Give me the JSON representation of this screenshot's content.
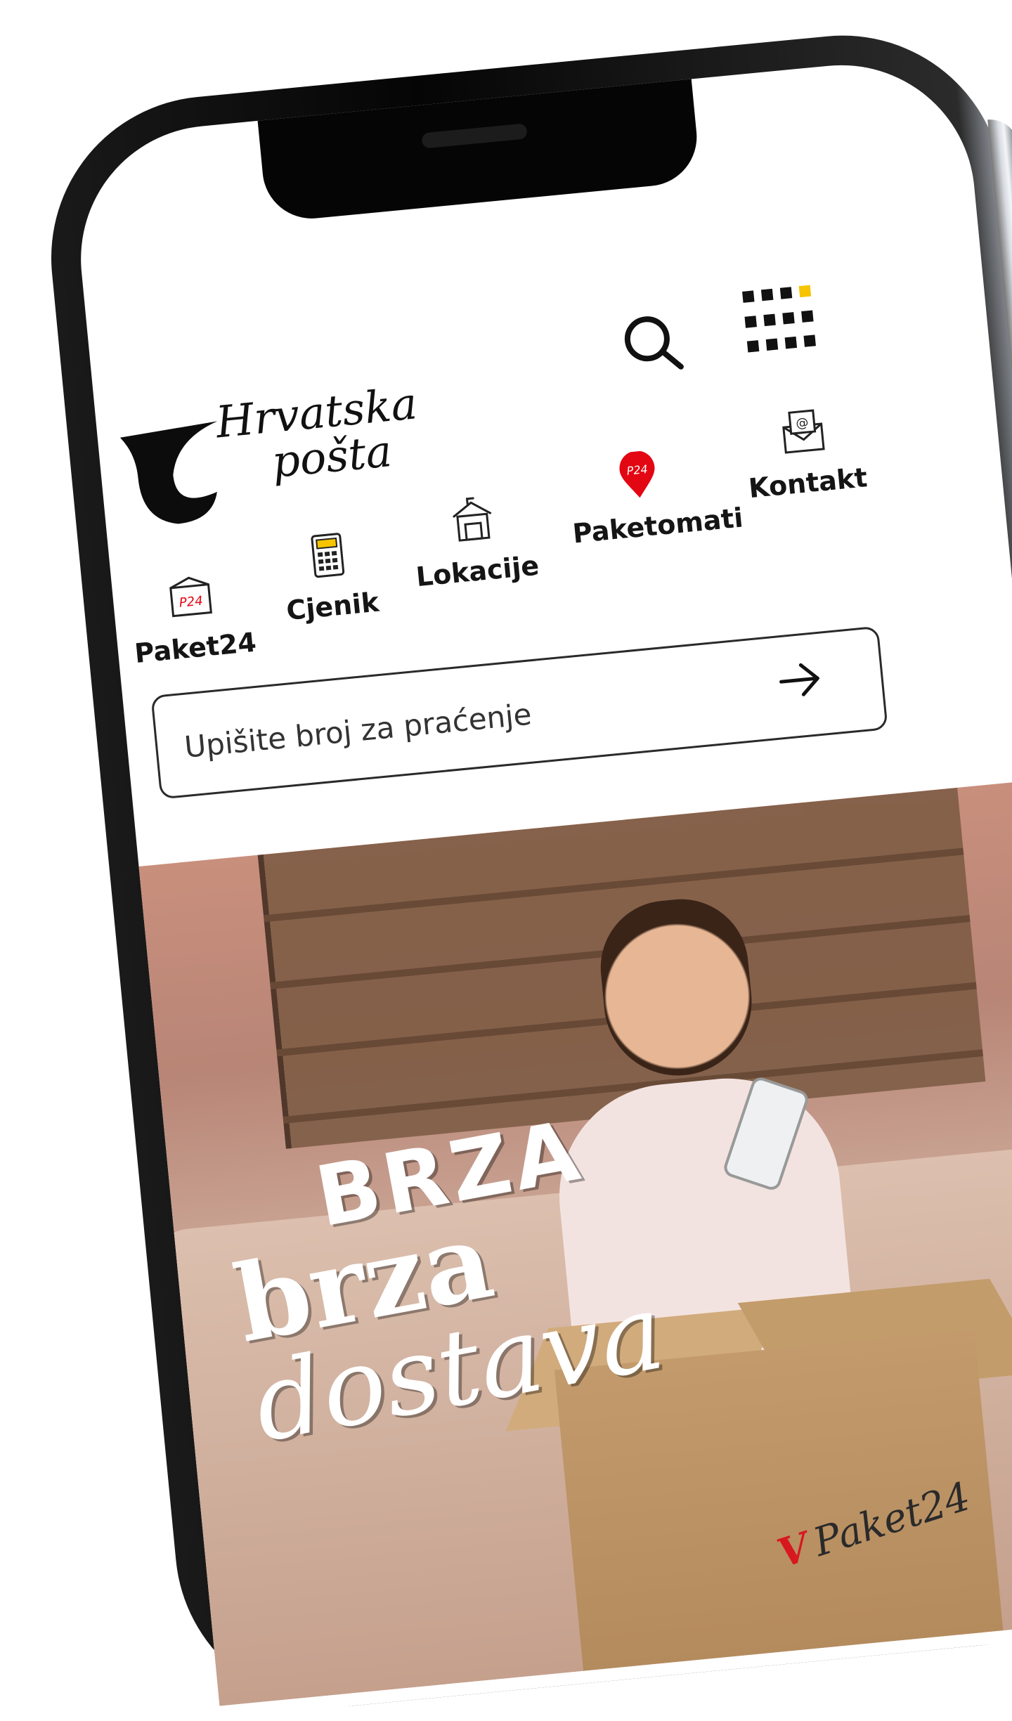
{
  "header": {
    "logo_line1": "Hrvatska",
    "logo_line2": "pošta"
  },
  "icons": {
    "search": "search-icon",
    "apps": "apps-grid-icon",
    "accent_color": "#f6c400",
    "brand_red": "#e30613"
  },
  "quick_links": [
    {
      "label": "Paket24",
      "icon": "package-icon"
    },
    {
      "label": "Cjenik",
      "icon": "calculator-icon"
    },
    {
      "label": "Lokacije",
      "icon": "post-office-icon"
    },
    {
      "label": "Paketomati",
      "icon": "map-pin-icon",
      "badge": "P24"
    },
    {
      "label": "Kontakt",
      "icon": "mail-icon"
    }
  ],
  "tracking": {
    "placeholder": "Upišite broj za praćenje"
  },
  "hero": {
    "line1": "BRZA",
    "line2": "brza",
    "line3": "dostava",
    "box_brand": "Paket24"
  }
}
